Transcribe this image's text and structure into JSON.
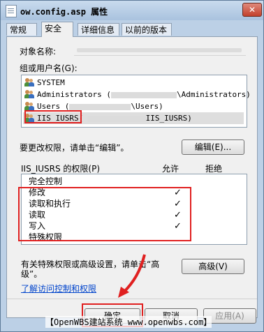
{
  "window": {
    "title": "ow.config.asp 属性",
    "close_glyph": "✕"
  },
  "tabs": [
    {
      "label": "常规"
    },
    {
      "label": "安全",
      "active": true
    },
    {
      "label": "详细信息"
    },
    {
      "label": "以前的版本"
    }
  ],
  "security": {
    "object_name_label": "对象名称:",
    "group_label": "组或用户名(G):",
    "users": [
      {
        "name": "SYSTEM",
        "suffix": ""
      },
      {
        "name": "Administrators (",
        "suffix": "\\Administrators)"
      },
      {
        "name": "Users (",
        "suffix": "\\Users)"
      },
      {
        "name": "IIS_IUSRS",
        "suffix": "IIS_IUSRS)",
        "selected": true
      }
    ],
    "edit_hint": "要更改权限，请单击“编辑”。",
    "edit_button": "编辑(E)...",
    "perm_header": "IIS_IUSRS 的权限(P)",
    "allow_col": "允许",
    "deny_col": "拒绝",
    "permissions": [
      {
        "name": "完全控制",
        "allow": ""
      },
      {
        "name": "修改",
        "allow": "✓"
      },
      {
        "name": "读取和执行",
        "allow": "✓"
      },
      {
        "name": "读取",
        "allow": "✓"
      },
      {
        "name": "写入",
        "allow": "✓"
      },
      {
        "name": "特殊权限",
        "allow": ""
      }
    ],
    "special_hint_line1": "有关特殊权限或高级设置，请单击“高",
    "special_hint_line2": "级”。",
    "advanced_button": "高级(V)",
    "link": "了解访问控制和权限"
  },
  "buttons": {
    "ok": "确定",
    "cancel": "取消",
    "apply": "应用(A)"
  },
  "watermark": "【OpenWBS建站系统 www.openwbs.com】",
  "annotation_color": "#e02020"
}
